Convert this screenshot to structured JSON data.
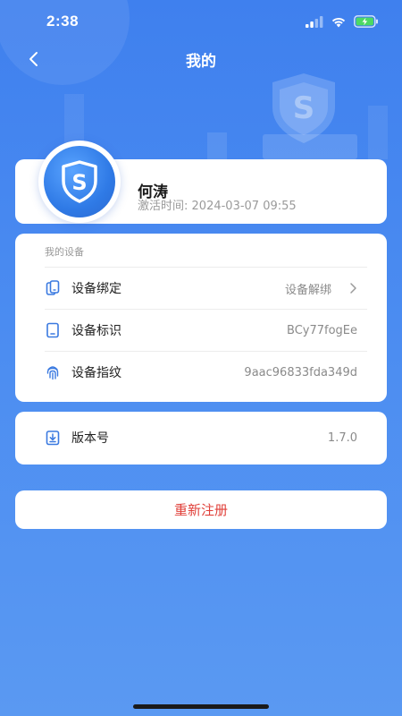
{
  "status_bar": {
    "time": "2:38"
  },
  "nav": {
    "title": "我的"
  },
  "profile": {
    "name": "何涛",
    "activation_label": "激活时间:",
    "activation_time": "2024-03-07 09:55"
  },
  "device": {
    "section_title": "我的设备",
    "rows": [
      {
        "label": "设备绑定",
        "value": "设备解绑",
        "icon": "phone-link-icon"
      },
      {
        "label": "设备标识",
        "value": "BCy77fogEe",
        "icon": "tablet-icon"
      },
      {
        "label": "设备指纹",
        "value": "9aac96833fda349d",
        "icon": "fingerprint-icon"
      }
    ]
  },
  "version": {
    "label": "版本号",
    "value": "1.7.0",
    "icon": "download-doc-icon"
  },
  "actions": {
    "reregister": "重新注册"
  },
  "colors": {
    "primary": "#3f80ee",
    "danger": "#e0403a",
    "text_secondary": "#8a8a8a"
  }
}
